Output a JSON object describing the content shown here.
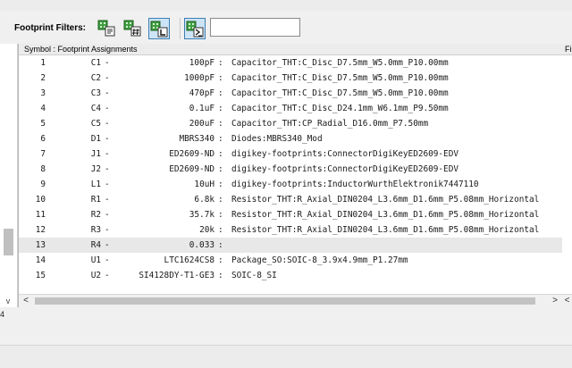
{
  "toolbar": {
    "label": "Footprint Filters:",
    "search_value": "",
    "buttons": [
      {
        "name": "filter-by-keywords",
        "icon": "footprint-keyword-icon",
        "active": false
      },
      {
        "name": "filter-by-pin-count",
        "icon": "footprint-pin-count-icon",
        "active": false
      },
      {
        "name": "filter-by-library",
        "icon": "footprint-library-icon",
        "active": true
      },
      {
        "name": "filter-by-text",
        "icon": "footprint-text-filter-icon",
        "active": true
      }
    ]
  },
  "panel": {
    "header": "Symbol : Footprint Assignments",
    "right_header": "Fi"
  },
  "rows": [
    {
      "num": "1",
      "ref": "C1",
      "value": "100pF",
      "footprint": "Capacitor_THT:C_Disc_D7.5mm_W5.0mm_P10.00mm"
    },
    {
      "num": "2",
      "ref": "C2",
      "value": "1000pF",
      "footprint": "Capacitor_THT:C_Disc_D7.5mm_W5.0mm_P10.00mm"
    },
    {
      "num": "3",
      "ref": "C3",
      "value": "470pF",
      "footprint": "Capacitor_THT:C_Disc_D7.5mm_W5.0mm_P10.00mm"
    },
    {
      "num": "4",
      "ref": "C4",
      "value": "0.1uF",
      "footprint": "Capacitor_THT:C_Disc_D24.1mm_W6.1mm_P9.50mm"
    },
    {
      "num": "5",
      "ref": "C5",
      "value": "200uF",
      "footprint": "Capacitor_THT:CP_Radial_D16.0mm_P7.50mm"
    },
    {
      "num": "6",
      "ref": "D1",
      "value": "MBRS340",
      "footprint": "Diodes:MBRS340_Mod"
    },
    {
      "num": "7",
      "ref": "J1",
      "value": "ED2609-ND",
      "footprint": "digikey-footprints:ConnectorDigiKeyED2609-EDV"
    },
    {
      "num": "8",
      "ref": "J2",
      "value": "ED2609-ND",
      "footprint": "digikey-footprints:ConnectorDigiKeyED2609-EDV"
    },
    {
      "num": "9",
      "ref": "L1",
      "value": "10uH",
      "footprint": "digikey-footprints:InductorWurthElektronik7447110"
    },
    {
      "num": "10",
      "ref": "R1",
      "value": "6.8k",
      "footprint": "Resistor_THT:R_Axial_DIN0204_L3.6mm_D1.6mm_P5.08mm_Horizontal"
    },
    {
      "num": "11",
      "ref": "R2",
      "value": "35.7k",
      "footprint": "Resistor_THT:R_Axial_DIN0204_L3.6mm_D1.6mm_P5.08mm_Horizontal"
    },
    {
      "num": "12",
      "ref": "R3",
      "value": "20k",
      "footprint": "Resistor_THT:R_Axial_DIN0204_L3.6mm_D1.6mm_P5.08mm_Horizontal"
    },
    {
      "num": "13",
      "ref": "R4",
      "value": "0.033",
      "footprint": "",
      "selected": true
    },
    {
      "num": "14",
      "ref": "U1",
      "value": "LTC1624CS8",
      "footprint": "Package_SO:SOIC-8_3.9x4.9mm_P1.27mm"
    },
    {
      "num": "15",
      "ref": "U2",
      "value": "SI4128DY-T1-GE3",
      "footprint": "SOIC-8_SI"
    }
  ],
  "status": {
    "count": "4"
  },
  "scroll": {
    "left_arrow": "<",
    "right_arrow": ">",
    "down_arrow": "v"
  }
}
